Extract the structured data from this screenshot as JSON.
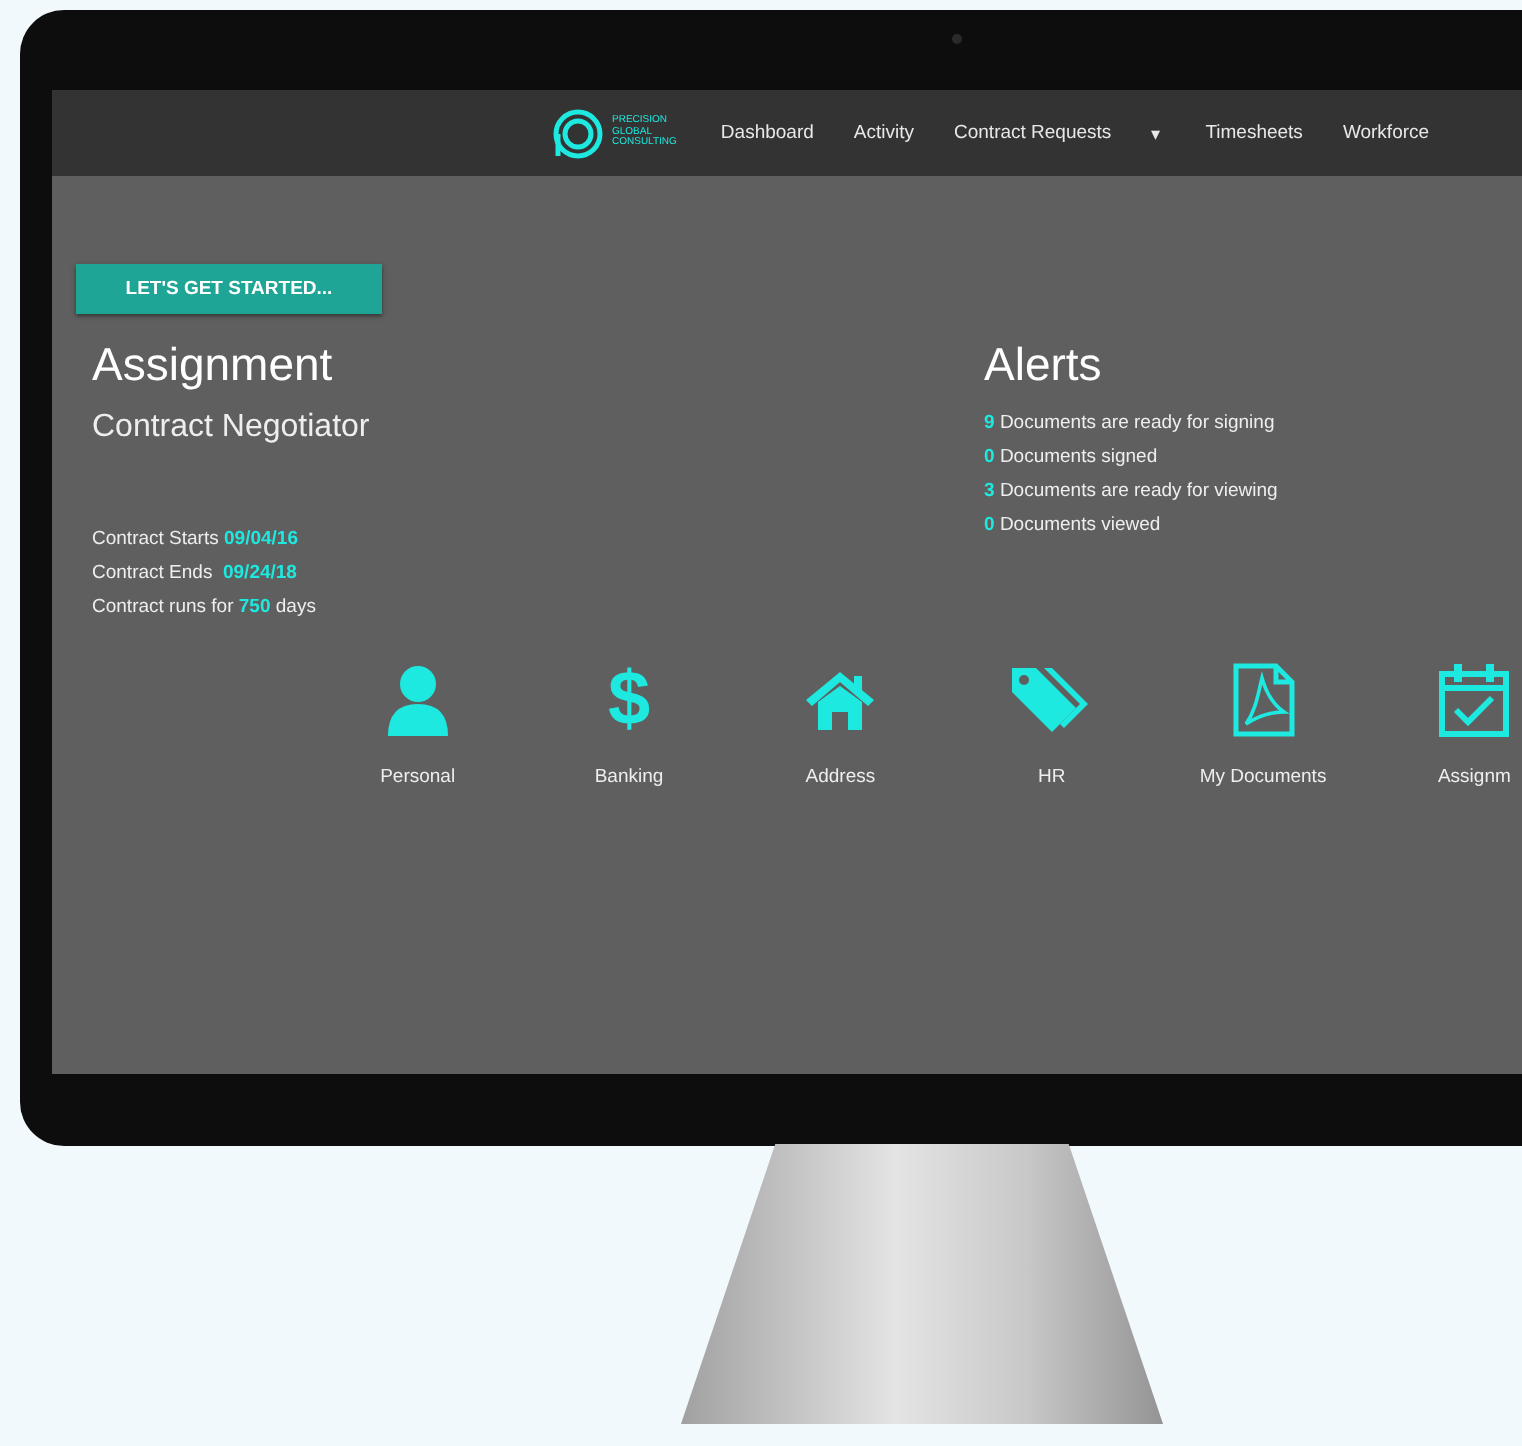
{
  "logo": {
    "lines": [
      "PRECISION",
      "GLOBAL",
      "CONSULTING"
    ]
  },
  "nav": [
    {
      "label": "Dashboard",
      "kind": "link"
    },
    {
      "label": "Activity",
      "kind": "link"
    },
    {
      "label": "Contract Requests",
      "kind": "link"
    },
    {
      "label": "▾",
      "kind": "dropdown"
    },
    {
      "label": "Timesheets",
      "kind": "link"
    },
    {
      "label": "Workforce",
      "kind": "link"
    }
  ],
  "start_button": "LET'S GET STARTED...",
  "assignment": {
    "heading": "Assignment",
    "role": "Contract Negotiator",
    "details": [
      {
        "label": "Contract Starts ",
        "value": "09/04/16"
      },
      {
        "label": "Contract Ends  ",
        "value": "09/24/18"
      },
      {
        "label": "Contract runs for ",
        "value": "750",
        "suffix": " days"
      }
    ]
  },
  "alerts": {
    "heading": "Alerts",
    "items": [
      {
        "count": "9",
        "text": "Documents are ready for signing"
      },
      {
        "count": "0",
        "text": "Documents signed"
      },
      {
        "count": "3",
        "text": "Documents are ready for viewing"
      },
      {
        "count": "0",
        "text": "Documents viewed"
      }
    ]
  },
  "tiles": [
    {
      "kind": "person",
      "label": "Personal"
    },
    {
      "kind": "glyph",
      "glyph": "$",
      "label": "Banking"
    },
    {
      "kind": "house",
      "label": "Address"
    },
    {
      "kind": "tags",
      "label": "HR"
    },
    {
      "kind": "pdf",
      "label": "My Documents"
    },
    {
      "kind": "calendar",
      "label": "Assignm"
    }
  ]
}
